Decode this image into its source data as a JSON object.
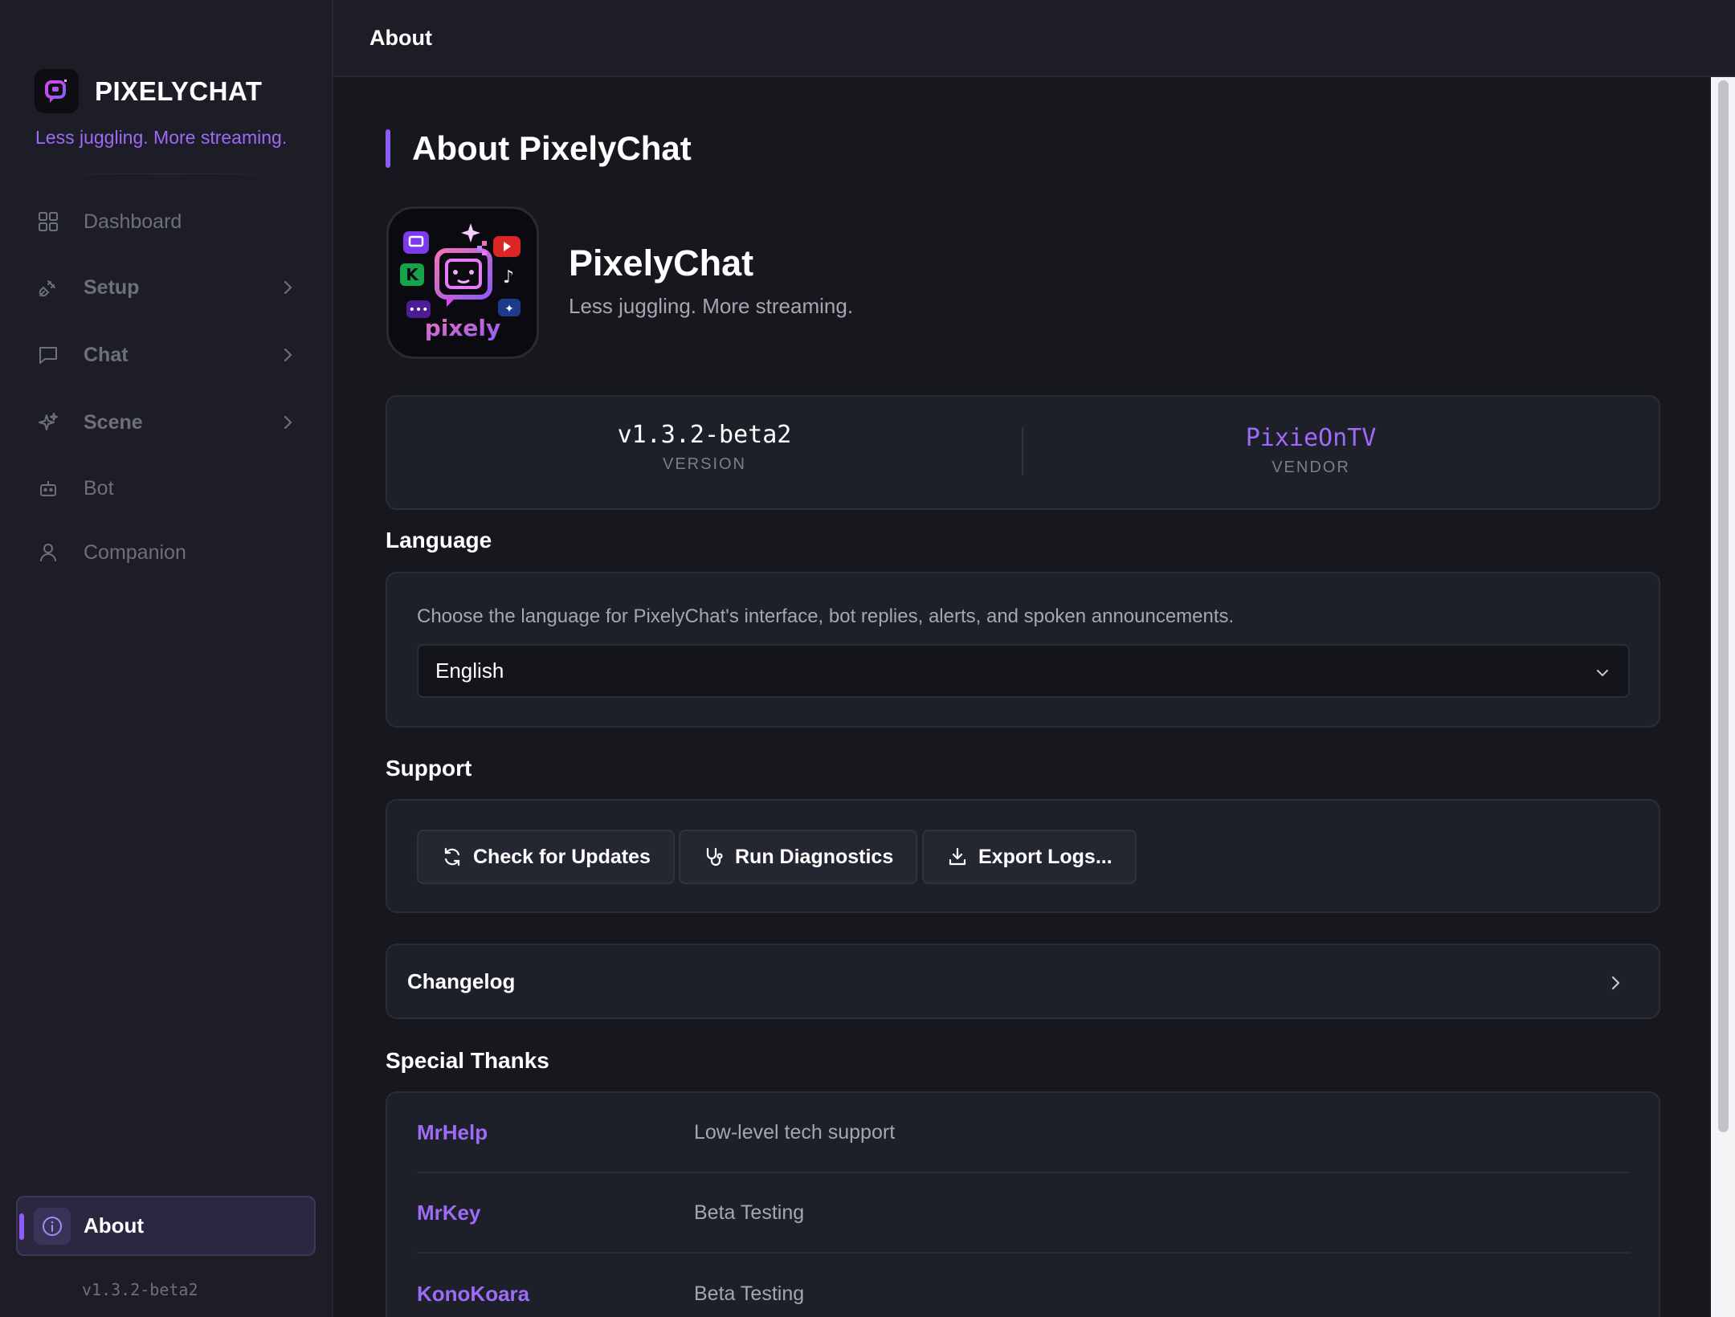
{
  "brand": {
    "name": "PIXELYCHAT",
    "tagline": "Less juggling. More streaming."
  },
  "sidebar": {
    "items": [
      {
        "label": "Dashboard",
        "icon": "grid-icon"
      },
      {
        "label": "Setup",
        "icon": "plug-icon"
      },
      {
        "label": "Chat",
        "icon": "message-square-icon"
      },
      {
        "label": "Scene",
        "icon": "sparkles-icon"
      },
      {
        "label": "Bot",
        "icon": "bot-icon"
      },
      {
        "label": "Companion",
        "icon": "user-icon"
      }
    ],
    "active": {
      "label": "About",
      "icon": "info-icon"
    },
    "version": "v1.3.2-beta2"
  },
  "header": {
    "title": "About"
  },
  "page": {
    "title": "About PixelyChat",
    "app_name": "PixelyChat",
    "app_tagline": "Less juggling. More streaming.",
    "app_icon_text": "pixely",
    "version": {
      "value": "v1.3.2-beta2",
      "label": "VERSION"
    },
    "vendor": {
      "value": "PixieOnTV",
      "label": "VENDOR"
    }
  },
  "language": {
    "heading": "Language",
    "description": "Choose the language for PixelyChat's interface, bot replies, alerts, and spoken announcements.",
    "selected": "English"
  },
  "support": {
    "heading": "Support",
    "buttons": [
      {
        "label": "Check for Updates",
        "icon": "refresh-icon"
      },
      {
        "label": "Run Diagnostics",
        "icon": "stethoscope-icon"
      },
      {
        "label": "Export Logs...",
        "icon": "download-icon"
      }
    ]
  },
  "changelog": {
    "label": "Changelog"
  },
  "thanks": {
    "heading": "Special Thanks",
    "rows": [
      {
        "name": "MrHelp",
        "role": "Low-level tech support"
      },
      {
        "name": "MrKey",
        "role": "Beta Testing"
      },
      {
        "name": "KonoKoara",
        "role": "Beta Testing"
      }
    ]
  },
  "colors": {
    "accent": "#8b5cf6",
    "accent_text": "#9d6bf5",
    "background": "#17181e",
    "sidebar": "#1c1d26",
    "card": "#1d1f29"
  }
}
